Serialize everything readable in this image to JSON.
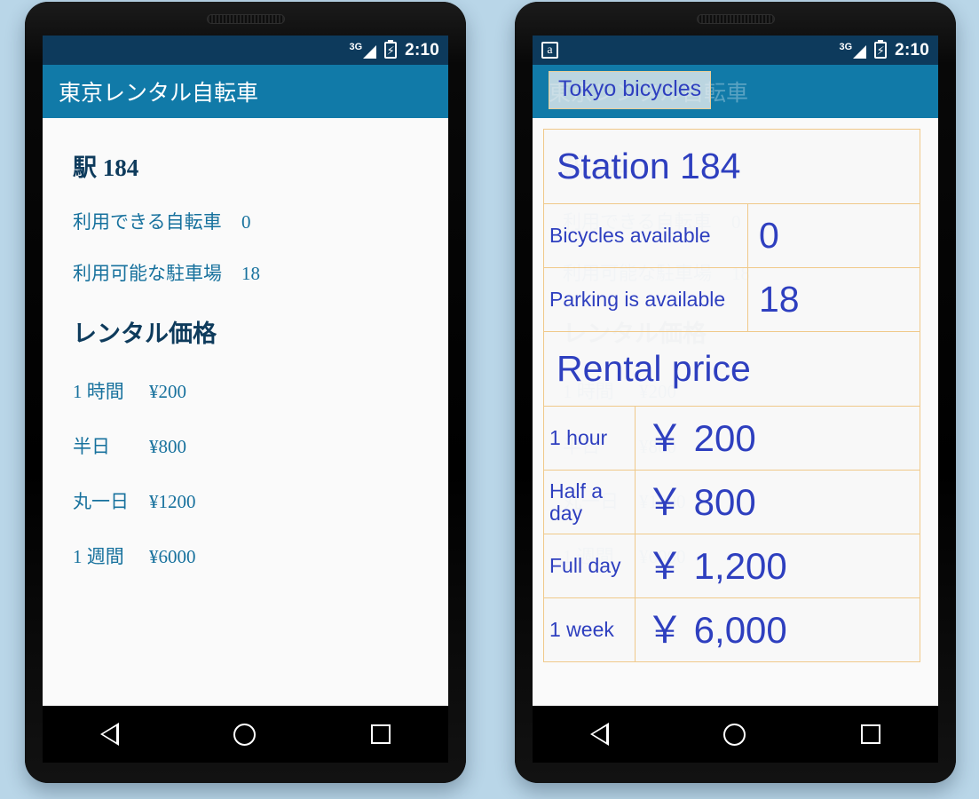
{
  "background_color": "#b9d6e8",
  "theme": {
    "status_bar": "#0d3a5c",
    "action_bar": "#117aa8",
    "heading": "#0e3b5c",
    "body_text": "#17719d",
    "translation_text": "#2e3fbf",
    "translation_border": "#f0c98a",
    "screen_bg": "#fafafa"
  },
  "phones": {
    "left": {
      "label": "original-japanese-screen",
      "status_bar": {
        "network": "3G",
        "time": "2:10",
        "battery_icon": "battery-charging-icon",
        "signal_icon": "signal-3g-icon"
      },
      "action_bar": {
        "title": "東京レンタル自転車"
      },
      "content": {
        "station_heading": "駅 184",
        "availability": [
          {
            "label": "利用できる自転車",
            "value": "0"
          },
          {
            "label": "利用可能な駐車場",
            "value": "18"
          }
        ],
        "price_heading": "レンタル価格",
        "prices": [
          {
            "label": "1 時間",
            "value": "¥200"
          },
          {
            "label": "半日",
            "value": "¥800"
          },
          {
            "label": "丸一日",
            "value": "¥1200"
          },
          {
            "label": "1 週間",
            "value": "¥6000"
          }
        ]
      },
      "nav_bar": {
        "back": "back-triangle-icon",
        "home": "home-circle-icon",
        "recents": "recents-square-icon"
      }
    },
    "right": {
      "label": "translated-english-screen",
      "status_bar": {
        "translate_badge": "a",
        "network": "3G",
        "time": "2:10",
        "battery_icon": "battery-charging-icon",
        "signal_icon": "signal-3g-icon"
      },
      "action_bar": {
        "original_title": "東京レンタル自転車",
        "translated_title": "Tokyo bicycles"
      },
      "content": {
        "station_heading": "Station 184",
        "station_heading_original": "駅 184",
        "availability": [
          {
            "label": "Bicycles available",
            "value": "0",
            "original_label": "利用できる自転車",
            "original_value": "0"
          },
          {
            "label": "Parking is available",
            "value": "18",
            "original_label": "利用可能な駐車場",
            "original_value": "18"
          }
        ],
        "price_heading": "Rental price",
        "price_heading_original": "レンタル価格",
        "prices": [
          {
            "label": "1 hour",
            "value": "￥ 200",
            "original_label": "1 時間",
            "original_value": "¥200"
          },
          {
            "label": "Half a day",
            "value": "￥ 800",
            "original_label": "半日",
            "original_value": "¥800"
          },
          {
            "label": "Full day",
            "value": "￥ 1,200",
            "original_label": "丸一日",
            "original_value": "¥1200"
          },
          {
            "label": "1 week",
            "value": "￥ 6,000",
            "original_label": "1 週間",
            "original_value": "¥6000"
          }
        ]
      },
      "nav_bar": {
        "back": "back-triangle-icon",
        "home": "home-circle-icon",
        "recents": "recents-square-icon"
      }
    }
  }
}
